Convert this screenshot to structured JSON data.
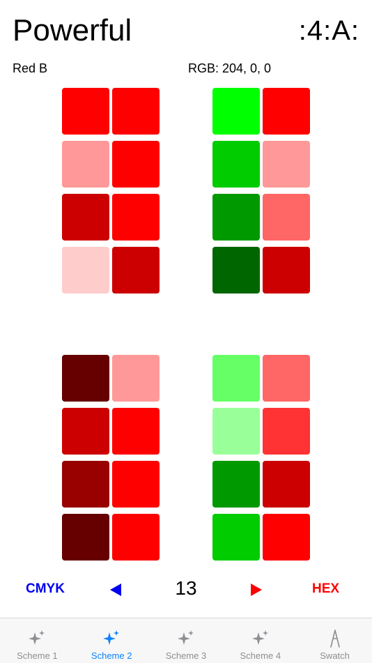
{
  "header": {
    "title": "Powerful",
    "menu_label": ":4:A:"
  },
  "color": {
    "name": "Red B",
    "rgb_text": "RGB: 204, 0, 0"
  },
  "schemes": [
    {
      "id": "top-left",
      "colors": [
        "#ff0000",
        "#ff0000",
        "#ff9999",
        "#ff0000",
        "#cc0000",
        "#ff0000",
        "#ffcccc",
        "#cc0000"
      ]
    },
    {
      "id": "top-right",
      "colors": [
        "#00ff00",
        "#ff0000",
        "#00cc00",
        "#ff9999",
        "#009900",
        "#ff6666",
        "#006600",
        "#cc0000"
      ]
    },
    {
      "id": "bottom-left",
      "colors": [
        "#660000",
        "#ff9999",
        "#cc0000",
        "#ff0000",
        "#990000",
        "#ff0000",
        "#660000",
        "#ff0000"
      ]
    },
    {
      "id": "bottom-right",
      "colors": [
        "#66ff66",
        "#ff6666",
        "#99ff99",
        "#ff3333",
        "#009900",
        "#cc0000",
        "#00cc00",
        "#ff0000"
      ]
    }
  ],
  "nav": {
    "cmyk_label": "CMYK",
    "hex_label": "HEX",
    "number": "13",
    "cmyk_color": "#0000ee",
    "hex_color": "#ff0000"
  },
  "tabbar": {
    "items": [
      {
        "label": "Scheme 1",
        "icon": "sparkle-icon",
        "active": false
      },
      {
        "label": "Scheme 2",
        "icon": "sparkle-icon",
        "active": true
      },
      {
        "label": "Scheme 3",
        "icon": "sparkle-icon",
        "active": false
      },
      {
        "label": "Scheme 4",
        "icon": "sparkle-icon",
        "active": false
      },
      {
        "label": "Swatch",
        "icon": "swatch-icon",
        "active": false
      }
    ],
    "active_color": "#0a84ff",
    "inactive_color": "#8e8e93"
  }
}
